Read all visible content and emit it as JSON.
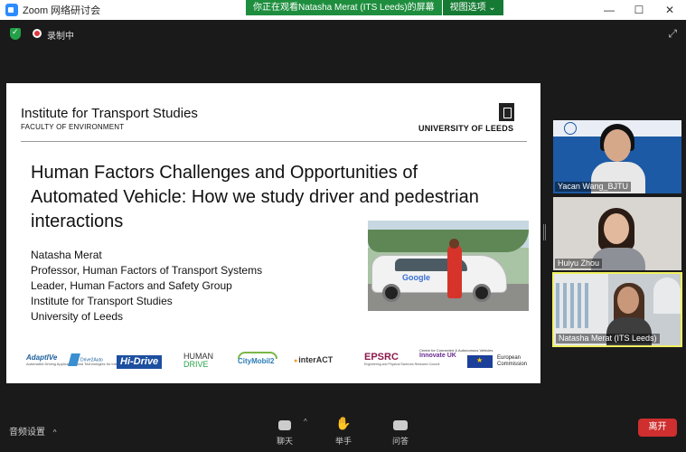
{
  "window": {
    "title": "Zoom 网络研讨会",
    "minimize": "—",
    "maximize": "☐",
    "close": "✕"
  },
  "banner": {
    "message": "你正在观看Natasha Merat (ITS Leeds)的屏幕",
    "view_options": "视图选项 ⌄"
  },
  "topbar": {
    "recording": "录制中",
    "expand_glyph": "⤢"
  },
  "slide": {
    "institute": "Institute for Transport Studies",
    "faculty": "FACULTY OF ENVIRONMENT",
    "university": "UNIVERSITY OF LEEDS",
    "headline": "Human Factors Challenges and Opportunities of Automated Vehicle: How we study driver and pedestrian interactions",
    "author_lines": [
      "Natasha Merat",
      "Professor, Human Factors of Transport Systems",
      "Leader, Human Factors and Safety Group",
      "Institute for Transport Studies",
      "University of Leeds"
    ],
    "car_logo_text": "Google",
    "logos": {
      "adaptive": "AdaptIVe",
      "adaptive_sub": "Automated Driving Applications and Technologies for Intelligent Vehicles",
      "drive": "Drive2Auto",
      "hidrive": "Hi-Drive",
      "human": "HUMAN",
      "human_drive": "DRIVE",
      "citymobil": "CityMobil2",
      "interact": "interACT",
      "epsrc": "EPSRC",
      "epsrc_sub": "Engineering and Physical Sciences Research Council",
      "ccav": "Centre for Connected & Autonomous Vehicles",
      "innovate": "Innovate UK",
      "ec_line1": "European",
      "ec_line2": "Commission"
    }
  },
  "participants": [
    {
      "name": "Yacan Wang_BJTU"
    },
    {
      "name": "Huiyu Zhou"
    },
    {
      "name": "Natasha Merat (ITS Leeds)"
    }
  ],
  "toolbar": {
    "audio": "音频设置",
    "audio_caret": "^",
    "chat": "聊天",
    "chat_caret": "^",
    "raise_hand": "举手",
    "raise_hand_glyph": "✋",
    "qa": "问答",
    "leave": "离开"
  },
  "colors": {
    "accent": "#2d8cff",
    "banner_green": "#1e8e3e",
    "leave_red": "#cf2f2f",
    "active_speaker": "#f1f15f"
  }
}
